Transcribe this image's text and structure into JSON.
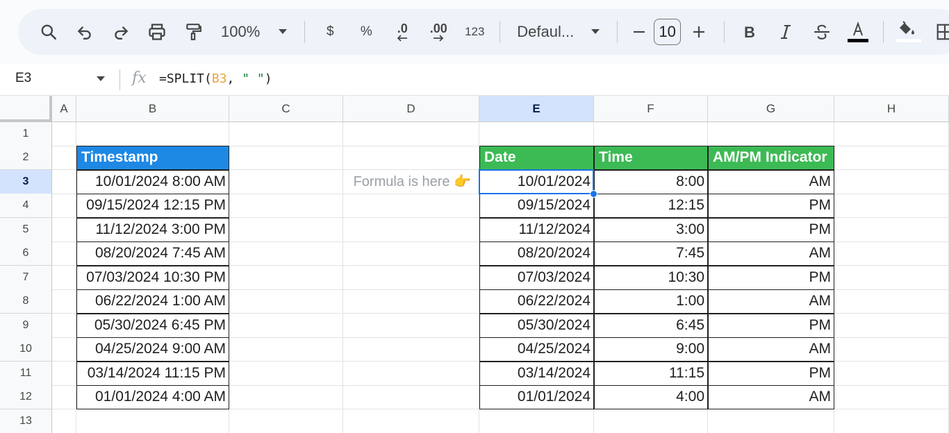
{
  "toolbar": {
    "zoom": "100%",
    "currency_label": "$",
    "percent_label": "%",
    "decrease_decimal_label": ".0",
    "increase_decimal_label": ".00",
    "more_formats_label": "123",
    "font_name": "Defaul...",
    "font_size": "10",
    "text_color": "#000000",
    "fill_color": "#ffffff",
    "icons": [
      "search-icon",
      "undo-icon",
      "redo-icon",
      "print-icon",
      "paint-format-icon",
      "chevron-down-icon",
      "minus-icon",
      "plus-icon",
      "bold-icon",
      "italic-icon",
      "strikethrough-icon",
      "text-color-icon",
      "fill-color-icon",
      "borders-icon"
    ]
  },
  "formula_bar": {
    "cell_ref": "E3",
    "formula_prefix": "=SPLIT(",
    "formula_ref": "B3",
    "formula_mid": ", ",
    "formula_str": "\" \"",
    "formula_suffix": ")"
  },
  "columns": [
    "A",
    "B",
    "C",
    "D",
    "E",
    "F",
    "G",
    "H"
  ],
  "active_column": "E",
  "rows": [
    "1",
    "2",
    "3",
    "4",
    "5",
    "6",
    "7",
    "8",
    "9",
    "10",
    "11",
    "12",
    "13"
  ],
  "active_row": "3",
  "timestamp_header": "Timestamp",
  "timestamps": [
    "10/01/2024 8:00 AM",
    "09/15/2024 12:15 PM",
    "11/12/2024 3:00 PM",
    "08/20/2024 7:45 AM",
    "07/03/2024 10:30 PM",
    "06/22/2024 1:00 AM",
    "05/30/2024 6:45 PM",
    "04/25/2024 9:00 AM",
    "03/14/2024 11:15 PM",
    "01/01/2024 4:00 AM"
  ],
  "note": "Formula is here 👉",
  "result_headers": [
    "Date",
    "Time",
    "AM/PM Indicator"
  ],
  "results": [
    [
      "10/01/2024",
      "8:00",
      "AM"
    ],
    [
      "09/15/2024",
      "12:15",
      "PM"
    ],
    [
      "11/12/2024",
      "3:00",
      "PM"
    ],
    [
      "08/20/2024",
      "7:45",
      "AM"
    ],
    [
      "07/03/2024",
      "10:30",
      "PM"
    ],
    [
      "06/22/2024",
      "1:00",
      "AM"
    ],
    [
      "05/30/2024",
      "6:45",
      "PM"
    ],
    [
      "04/25/2024",
      "9:00",
      "AM"
    ],
    [
      "03/14/2024",
      "11:15",
      "PM"
    ],
    [
      "01/01/2024",
      "4:00",
      "AM"
    ]
  ],
  "colors": {
    "timestamp_header_bg": "#1e88e5",
    "result_header_bg": "#3cba54",
    "selection": "#1a73e8"
  }
}
